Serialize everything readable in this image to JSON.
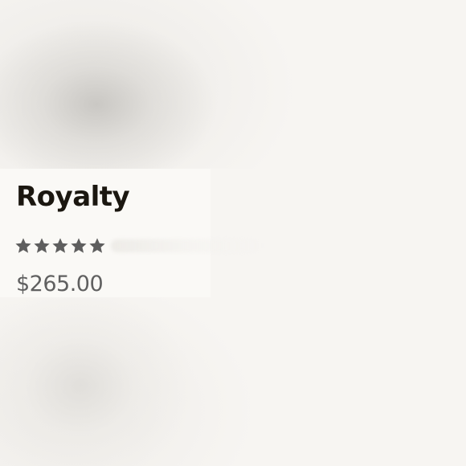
{
  "product": {
    "title": "Royalty",
    "price": "$265.00",
    "rating": {
      "stars_filled": 5,
      "stars_total": 5,
      "icon": "star-icon",
      "color": "#5e5e5e"
    }
  },
  "colors": {
    "background": "#f7f5f2",
    "title": "#1b1710",
    "price": "#606060"
  }
}
